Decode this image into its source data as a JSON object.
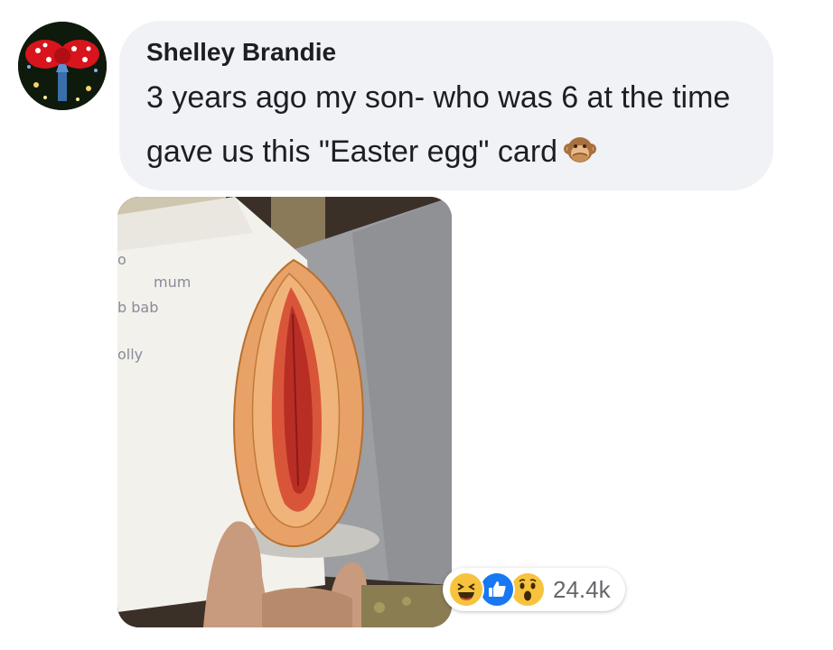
{
  "comment": {
    "author": "Shelley Brandie",
    "text": "3 years ago my son- who was 6 at the time gave us this \"Easter egg\" card",
    "inline_emoji": "see-no-evil-monkey-icon"
  },
  "avatar": {
    "icon": "minnie-bow-avatar"
  },
  "photo": {
    "card_handwriting": [
      "o",
      "mum",
      "b bab",
      "olly"
    ]
  },
  "reactions": {
    "icons": [
      "haha-reaction-icon",
      "like-reaction-icon",
      "wow-reaction-icon"
    ],
    "count": "24.4k"
  },
  "colors": {
    "bubble_bg": "#f0f2f5",
    "text": "#1c1e21",
    "like_blue": "#1877f2",
    "reaction_yellow": "#f7c33e",
    "count_gray": "#65676b"
  }
}
